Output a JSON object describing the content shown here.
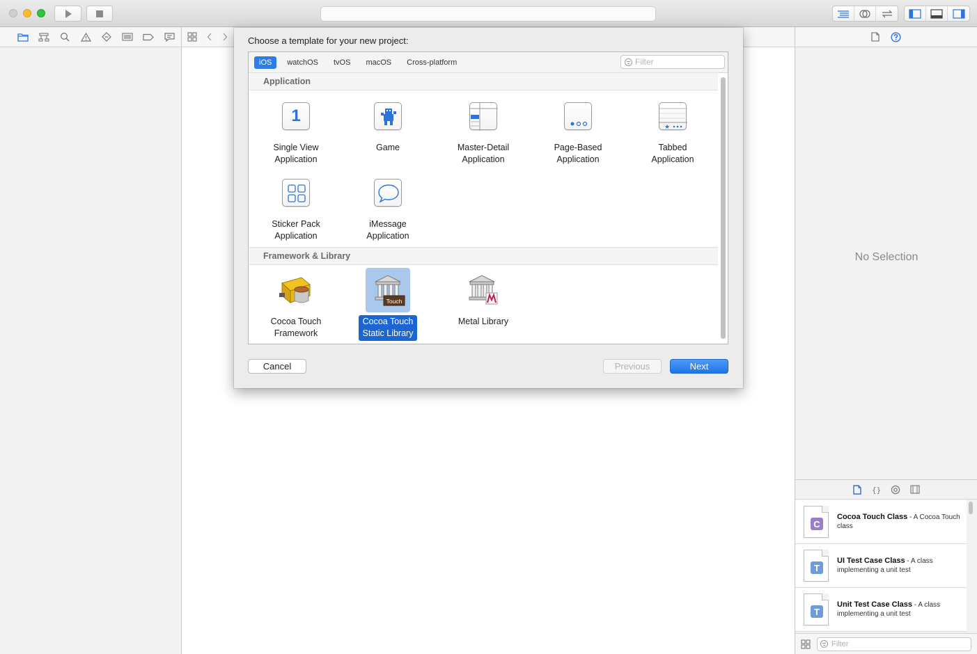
{
  "sheet": {
    "title": "Choose a template for your new project:",
    "platform_tabs": [
      {
        "label": "iOS",
        "active": true
      },
      {
        "label": "watchOS",
        "active": false
      },
      {
        "label": "tvOS",
        "active": false
      },
      {
        "label": "macOS",
        "active": false
      },
      {
        "label": "Cross-platform",
        "active": false
      }
    ],
    "filter_placeholder": "Filter",
    "sections": {
      "application": {
        "heading": "Application",
        "templates": [
          {
            "label": "Single View\nApplication",
            "icon": "single-view-icon"
          },
          {
            "label": "Game",
            "icon": "game-icon"
          },
          {
            "label": "Master-Detail\nApplication",
            "icon": "master-detail-icon"
          },
          {
            "label": "Page-Based\nApplication",
            "icon": "page-based-icon"
          },
          {
            "label": "Tabbed\nApplication",
            "icon": "tabbed-icon"
          },
          {
            "label": "Sticker Pack\nApplication",
            "icon": "sticker-pack-icon"
          },
          {
            "label": "iMessage\nApplication",
            "icon": "imessage-icon"
          }
        ]
      },
      "framework": {
        "heading": "Framework & Library",
        "templates": [
          {
            "label": "Cocoa Touch\nFramework",
            "icon": "toolbox-icon",
            "selected": false
          },
          {
            "label": "Cocoa Touch\nStatic Library",
            "icon": "static-library-icon",
            "selected": true,
            "badge": "Touch"
          },
          {
            "label": "Metal Library",
            "icon": "metal-library-icon",
            "selected": false
          }
        ]
      }
    },
    "buttons": {
      "cancel": "Cancel",
      "previous": "Previous",
      "next": "Next"
    },
    "single_view_glyph": "1"
  },
  "inspector": {
    "empty_text": "No Selection"
  },
  "library": {
    "items": [
      {
        "title": "Cocoa Touch Class",
        "desc": " - A Cocoa Touch class",
        "badge": "C",
        "badge_color": "#9a7fc6"
      },
      {
        "title": "UI Test Case Class",
        "desc": " - A class implementing a unit test",
        "badge": "T",
        "badge_color": "#6f9bd6"
      },
      {
        "title": "Unit Test Case Class",
        "desc": " - A class implementing a unit test",
        "badge": "T",
        "badge_color": "#6f9bd6"
      }
    ],
    "filter_placeholder": "Filter"
  },
  "colors": {
    "accent": "#1d66d1",
    "tab_active": "#2d7de4"
  }
}
